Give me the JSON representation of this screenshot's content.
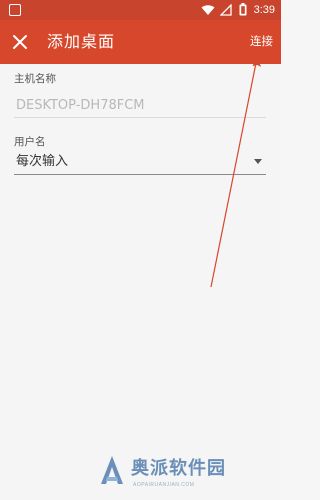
{
  "status_bar": {
    "time": "3:39",
    "color": "#c9442c"
  },
  "app_bar": {
    "title": "添加桌面",
    "close_icon": "close-icon",
    "action_label": "连接",
    "color": "#d7472b"
  },
  "form": {
    "host_label": "主机名称",
    "host_placeholder": "DESKTOP-DH78FCM",
    "host_value": "",
    "username_label": "用户名",
    "username_value": "每次输入"
  },
  "annotation": {
    "color": "#d7472b"
  },
  "watermark": {
    "text": "奥派软件园",
    "subtext": "AOPAIRUANJIAN.COM",
    "color": "#6b8fb8"
  }
}
